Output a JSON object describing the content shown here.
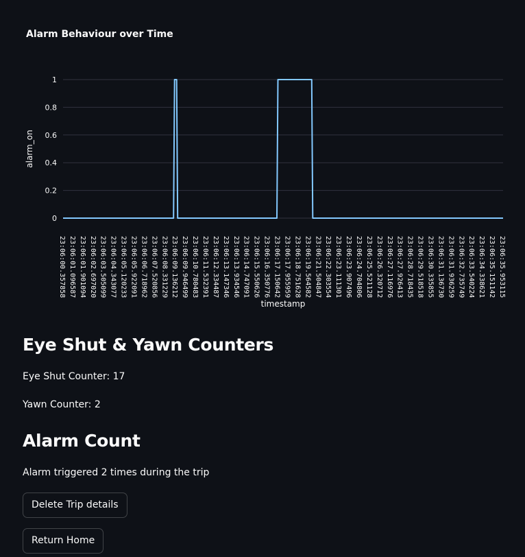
{
  "chart_data": {
    "type": "line",
    "title": "Alarm Behaviour over Time",
    "xlabel": "timestamp",
    "ylabel": "alarm_on",
    "ylim": [
      0,
      1
    ],
    "yticks": [
      "0",
      "0.2",
      "0.4",
      "0.6",
      "0.8",
      "1"
    ],
    "grid": true,
    "line_color": "#83c9ff",
    "x_tick_labels": [
      "23:06:00.357858",
      "23:06:01.096587",
      "23:06:01.901094",
      "23:06:02.697020",
      "23:06:03.505099",
      "23:06:04.343077",
      "23:06:05.120233",
      "23:06:05.922091",
      "23:06:06.718962",
      "23:06:07.520856",
      "23:06:08.331229",
      "23:06:09.136212",
      "23:06:09.946499",
      "23:06:10.780483",
      "23:06:11.532391",
      "23:06:12.334487",
      "23:06:13.147346",
      "23:06:13.934546",
      "23:06:14.747091",
      "23:06:15.550626",
      "23:06:16.350776",
      "23:06:17.150642",
      "23:06:17.955959",
      "23:06:18.751628",
      "23:06:19.564582",
      "23:06:21.504847",
      "23:06:22.303554",
      "23:06:23.111301",
      "23:06:23.907496",
      "23:06:24.704806",
      "23:06:25.521128",
      "23:06:26.320712",
      "23:06:27.116976",
      "23:06:27.926413",
      "23:06:28.718435",
      "23:06:29.518518",
      "23:06:30.335855",
      "23:06:31.136730",
      "23:06:31.936259",
      "23:06:32.735749",
      "23:06:33.540224",
      "23:06:34.338621",
      "23:06:35.151142",
      "23:06:35.953115"
    ],
    "series": [
      {
        "points": [
          [
            0,
            0
          ],
          [
            10.8,
            0
          ],
          [
            10.9,
            1
          ],
          [
            11.1,
            1
          ],
          [
            11.2,
            0
          ],
          [
            20.9,
            0
          ],
          [
            21.0,
            1
          ],
          [
            24.3,
            1
          ],
          [
            24.4,
            0
          ],
          [
            43.0,
            0
          ]
        ]
      }
    ]
  },
  "counters": {
    "heading": "Eye Shut & Yawn Counters",
    "eye_shut_label": "Eye Shut Counter:",
    "eye_shut_value": "17",
    "yawn_label": "Yawn Counter:",
    "yawn_value": "2"
  },
  "alarm": {
    "heading": "Alarm Count",
    "summary": "Alarm triggered 2 times during the trip"
  },
  "buttons": {
    "delete_label": "Delete Trip details",
    "home_label": "Return Home"
  }
}
